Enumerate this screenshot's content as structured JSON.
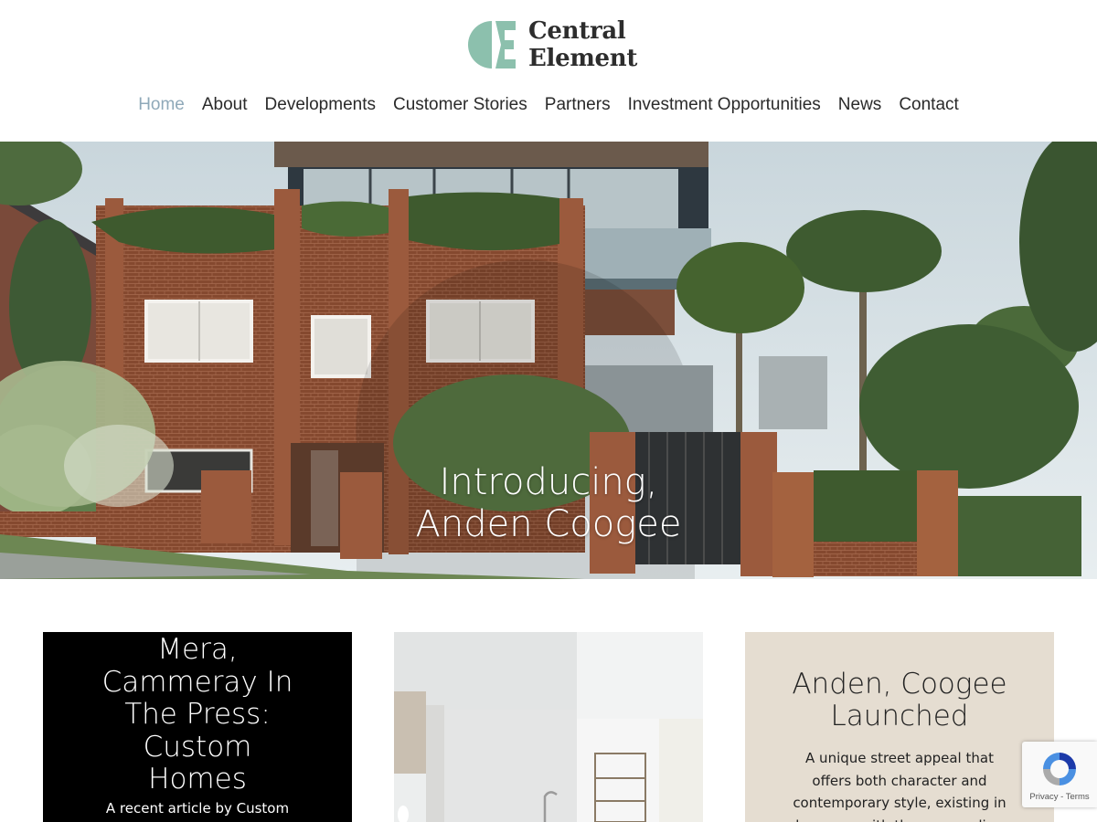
{
  "brand": {
    "name_line1": "Central",
    "name_line2": "Element",
    "logo_color": "#8cc0ad"
  },
  "nav": {
    "items": [
      {
        "label": "Home",
        "active": true
      },
      {
        "label": "About",
        "active": false
      },
      {
        "label": "Developments",
        "active": false
      },
      {
        "label": "Customer Stories",
        "active": false
      },
      {
        "label": "Partners",
        "active": false
      },
      {
        "label": "Investment Opportunities",
        "active": false
      },
      {
        "label": "News",
        "active": false
      },
      {
        "label": "Contact",
        "active": false
      }
    ],
    "active_color": "#8fa9b9"
  },
  "hero": {
    "line1": "Introducing,",
    "line2": "Anden Coogee"
  },
  "cards": [
    {
      "title_lines": [
        "Mera,",
        "Cammeray In",
        "The Press:",
        "Custom",
        "Homes"
      ],
      "excerpt": "A recent article by Custom",
      "background": "#000000"
    },
    {
      "title_lines": [],
      "excerpt": "",
      "background": "#e9eaea"
    },
    {
      "title_lines": [
        "Anden, Coogee",
        "Launched"
      ],
      "excerpt_lines": [
        "A unique street appeal that",
        "offers both character and",
        "contemporary style, existing in",
        "harmony with the surrounding"
      ],
      "background": "#e5ddd1"
    }
  ],
  "recaptcha": {
    "text": "Privacy - Terms"
  }
}
